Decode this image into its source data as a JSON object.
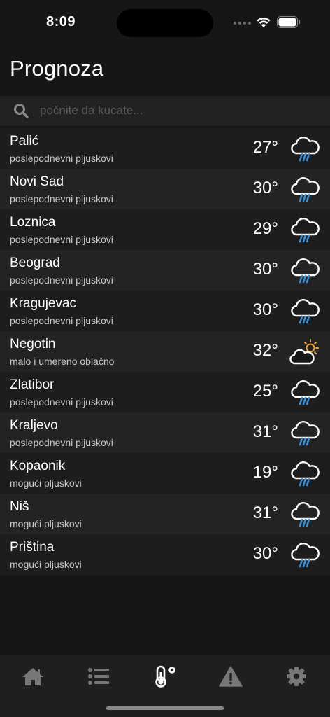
{
  "status": {
    "time": "8:09"
  },
  "header": {
    "title": "Prognoza"
  },
  "search": {
    "placeholder": "počnite da kucate..."
  },
  "forecast": [
    {
      "city": "Palić",
      "condition": "poslepodnevni pljuskovi",
      "temp": "27°",
      "icon": "rain-cloud-icon"
    },
    {
      "city": "Novi Sad",
      "condition": "poslepodnevni pljuskovi",
      "temp": "30°",
      "icon": "rain-cloud-icon"
    },
    {
      "city": "Loznica",
      "condition": "poslepodnevni pljuskovi",
      "temp": "29°",
      "icon": "rain-cloud-icon"
    },
    {
      "city": "Beograd",
      "condition": "poslepodnevni pljuskovi",
      "temp": "30°",
      "icon": "rain-cloud-icon"
    },
    {
      "city": "Kragujevac",
      "condition": "poslepodnevni pljuskovi",
      "temp": "30°",
      "icon": "rain-cloud-icon"
    },
    {
      "city": "Negotin",
      "condition": "malo i umereno oblačno",
      "temp": "32°",
      "icon": "partly-cloudy-icon"
    },
    {
      "city": "Zlatibor",
      "condition": "poslepodnevni pljuskovi",
      "temp": "25°",
      "icon": "rain-cloud-icon"
    },
    {
      "city": "Kraljevo",
      "condition": "poslepodnevni pljuskovi",
      "temp": "31°",
      "icon": "rain-cloud-icon"
    },
    {
      "city": "Kopaonik",
      "condition": "mogući pljuskovi",
      "temp": "19°",
      "icon": "rain-cloud-icon"
    },
    {
      "city": "Niš",
      "condition": "mogući pljuskovi",
      "temp": "31°",
      "icon": "rain-cloud-icon"
    },
    {
      "city": "Priština",
      "condition": "mogući pljuskovi",
      "temp": "30°",
      "icon": "rain-cloud-icon"
    }
  ],
  "tabs": [
    {
      "name": "tab-home",
      "icon": "home-icon",
      "active": false
    },
    {
      "name": "tab-list",
      "icon": "list-icon",
      "active": false
    },
    {
      "name": "tab-forecast",
      "icon": "thermometer-icon",
      "active": true
    },
    {
      "name": "tab-warnings",
      "icon": "warning-icon",
      "active": false
    },
    {
      "name": "tab-settings",
      "icon": "gear-icon",
      "active": false
    }
  ],
  "colors": {
    "background": "#161616",
    "row_odd": "#1d1d1d",
    "row_even": "#232323",
    "rain": "#3a8fd6",
    "sun": "#e9a13b",
    "tab_inactive": "#777777",
    "tab_active": "#ffffff"
  }
}
